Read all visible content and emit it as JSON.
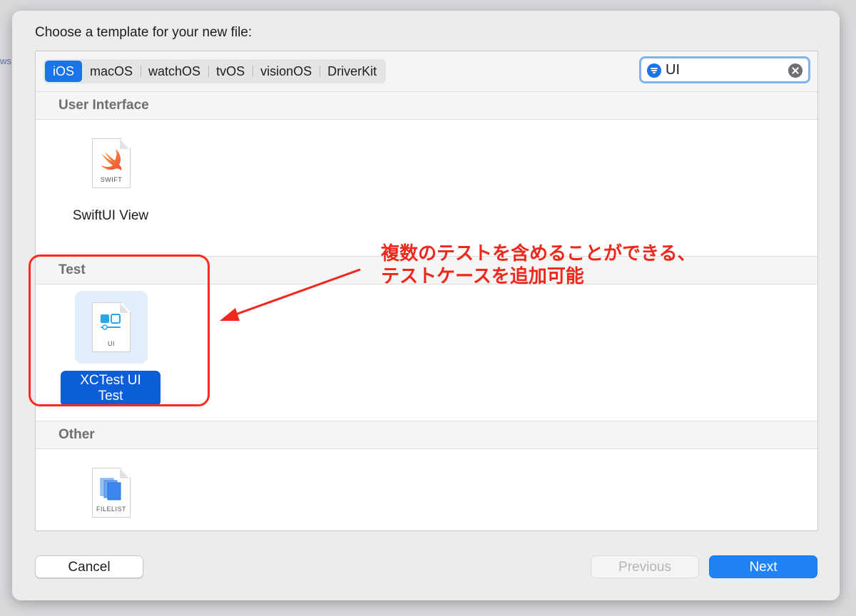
{
  "background": {
    "hint_text": "ws"
  },
  "dialog": {
    "prompt": "Choose a template for your new file:",
    "platform_tabs": [
      {
        "label": "iOS",
        "active": true
      },
      {
        "label": "macOS",
        "active": false
      },
      {
        "label": "watchOS",
        "active": false
      },
      {
        "label": "tvOS",
        "active": false
      },
      {
        "label": "visionOS",
        "active": false
      },
      {
        "label": "DriverKit",
        "active": false
      }
    ],
    "search": {
      "value": "UI",
      "filter_icon": "filter-icon",
      "clear_icon": "clear-icon"
    },
    "sections": [
      {
        "title": "User Interface",
        "templates": [
          {
            "label": "SwiftUI View",
            "icon_caption": "SWIFT",
            "icon": "swift-file-icon",
            "selected": false
          }
        ]
      },
      {
        "title": "Test",
        "templates": [
          {
            "label": "XCTest UI Test",
            "icon_caption": "UI",
            "icon": "ui-test-file-icon",
            "selected": true
          }
        ]
      },
      {
        "title": "Other",
        "templates": [
          {
            "label": "",
            "icon_caption": "FILELIST",
            "icon": "filelist-file-icon",
            "selected": false
          }
        ]
      }
    ],
    "buttons": {
      "cancel": "Cancel",
      "previous": "Previous",
      "next": "Next"
    }
  },
  "annotation": {
    "line1": "複数のテストを含めることができる、",
    "line2": "テストケースを追加可能",
    "color": "#f0281c"
  },
  "colors": {
    "accent": "#1a73e8",
    "selection": "#0b5ed7",
    "next_button": "#1f83f5",
    "annotation": "#ff2b1c"
  }
}
